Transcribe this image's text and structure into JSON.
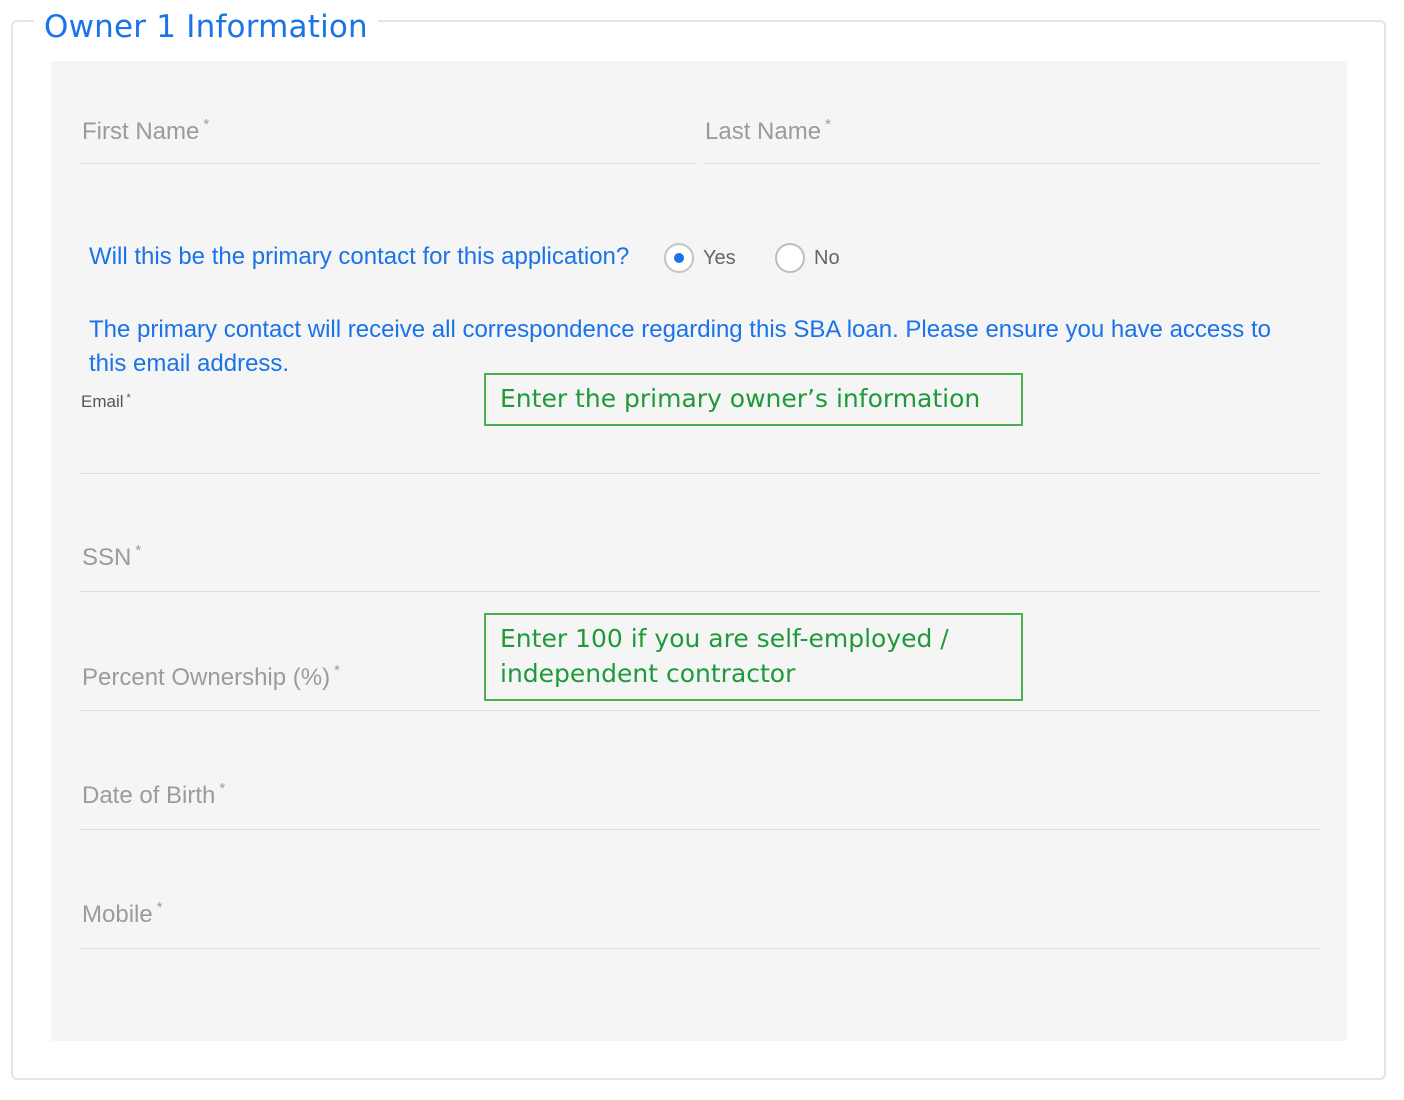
{
  "section": {
    "title": "Owner 1 Information"
  },
  "fields": {
    "first_name": {
      "label": "First Name",
      "required": "*"
    },
    "last_name": {
      "label": "Last Name",
      "required": "*"
    },
    "email": {
      "label": "Email",
      "required": "*"
    },
    "ssn": {
      "label": "SSN",
      "required": "*"
    },
    "percent_ownership": {
      "label": "Percent Ownership (%)",
      "required": "*"
    },
    "date_of_birth": {
      "label": "Date of Birth",
      "required": "*"
    },
    "mobile": {
      "label": "Mobile",
      "required": "*"
    }
  },
  "primary_contact": {
    "question": "Will this be the primary contact for this application?",
    "options": [
      {
        "label": "Yes",
        "selected": true
      },
      {
        "label": "No",
        "selected": false
      }
    ],
    "notice": "The primary contact will receive all correspondence regarding this SBA loan. Please ensure you have access to this email address."
  },
  "callouts": {
    "owner_info": "Enter the primary owner’s information",
    "ownership": "Enter 100 if you are self-employed / independent contractor"
  },
  "colors": {
    "accent": "#1a73e8",
    "callout_border": "#4caf50",
    "callout_text": "#1e9a3a",
    "panel_bg": "#f5f5f5"
  }
}
